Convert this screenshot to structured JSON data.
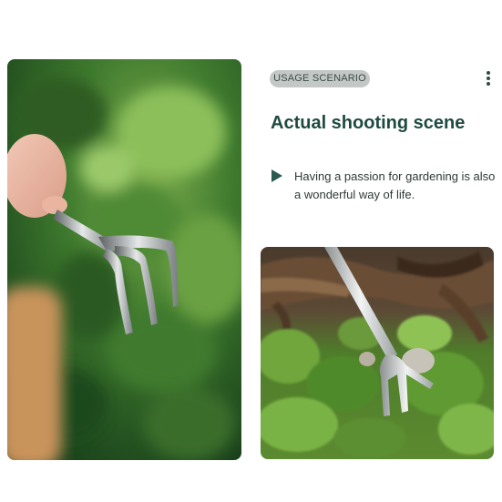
{
  "badge": {
    "label": "USAGE SCENARIO"
  },
  "title": "Actual shooting scene",
  "description": "Having a passion for gardening is also a wonderful way of life.",
  "icons": {
    "menu": "more-vertical-icon",
    "bullet": "play-icon"
  },
  "colors": {
    "title": "#1f4a40",
    "badge_bg": "#c3c8c6",
    "accent": "#2d5a50"
  }
}
